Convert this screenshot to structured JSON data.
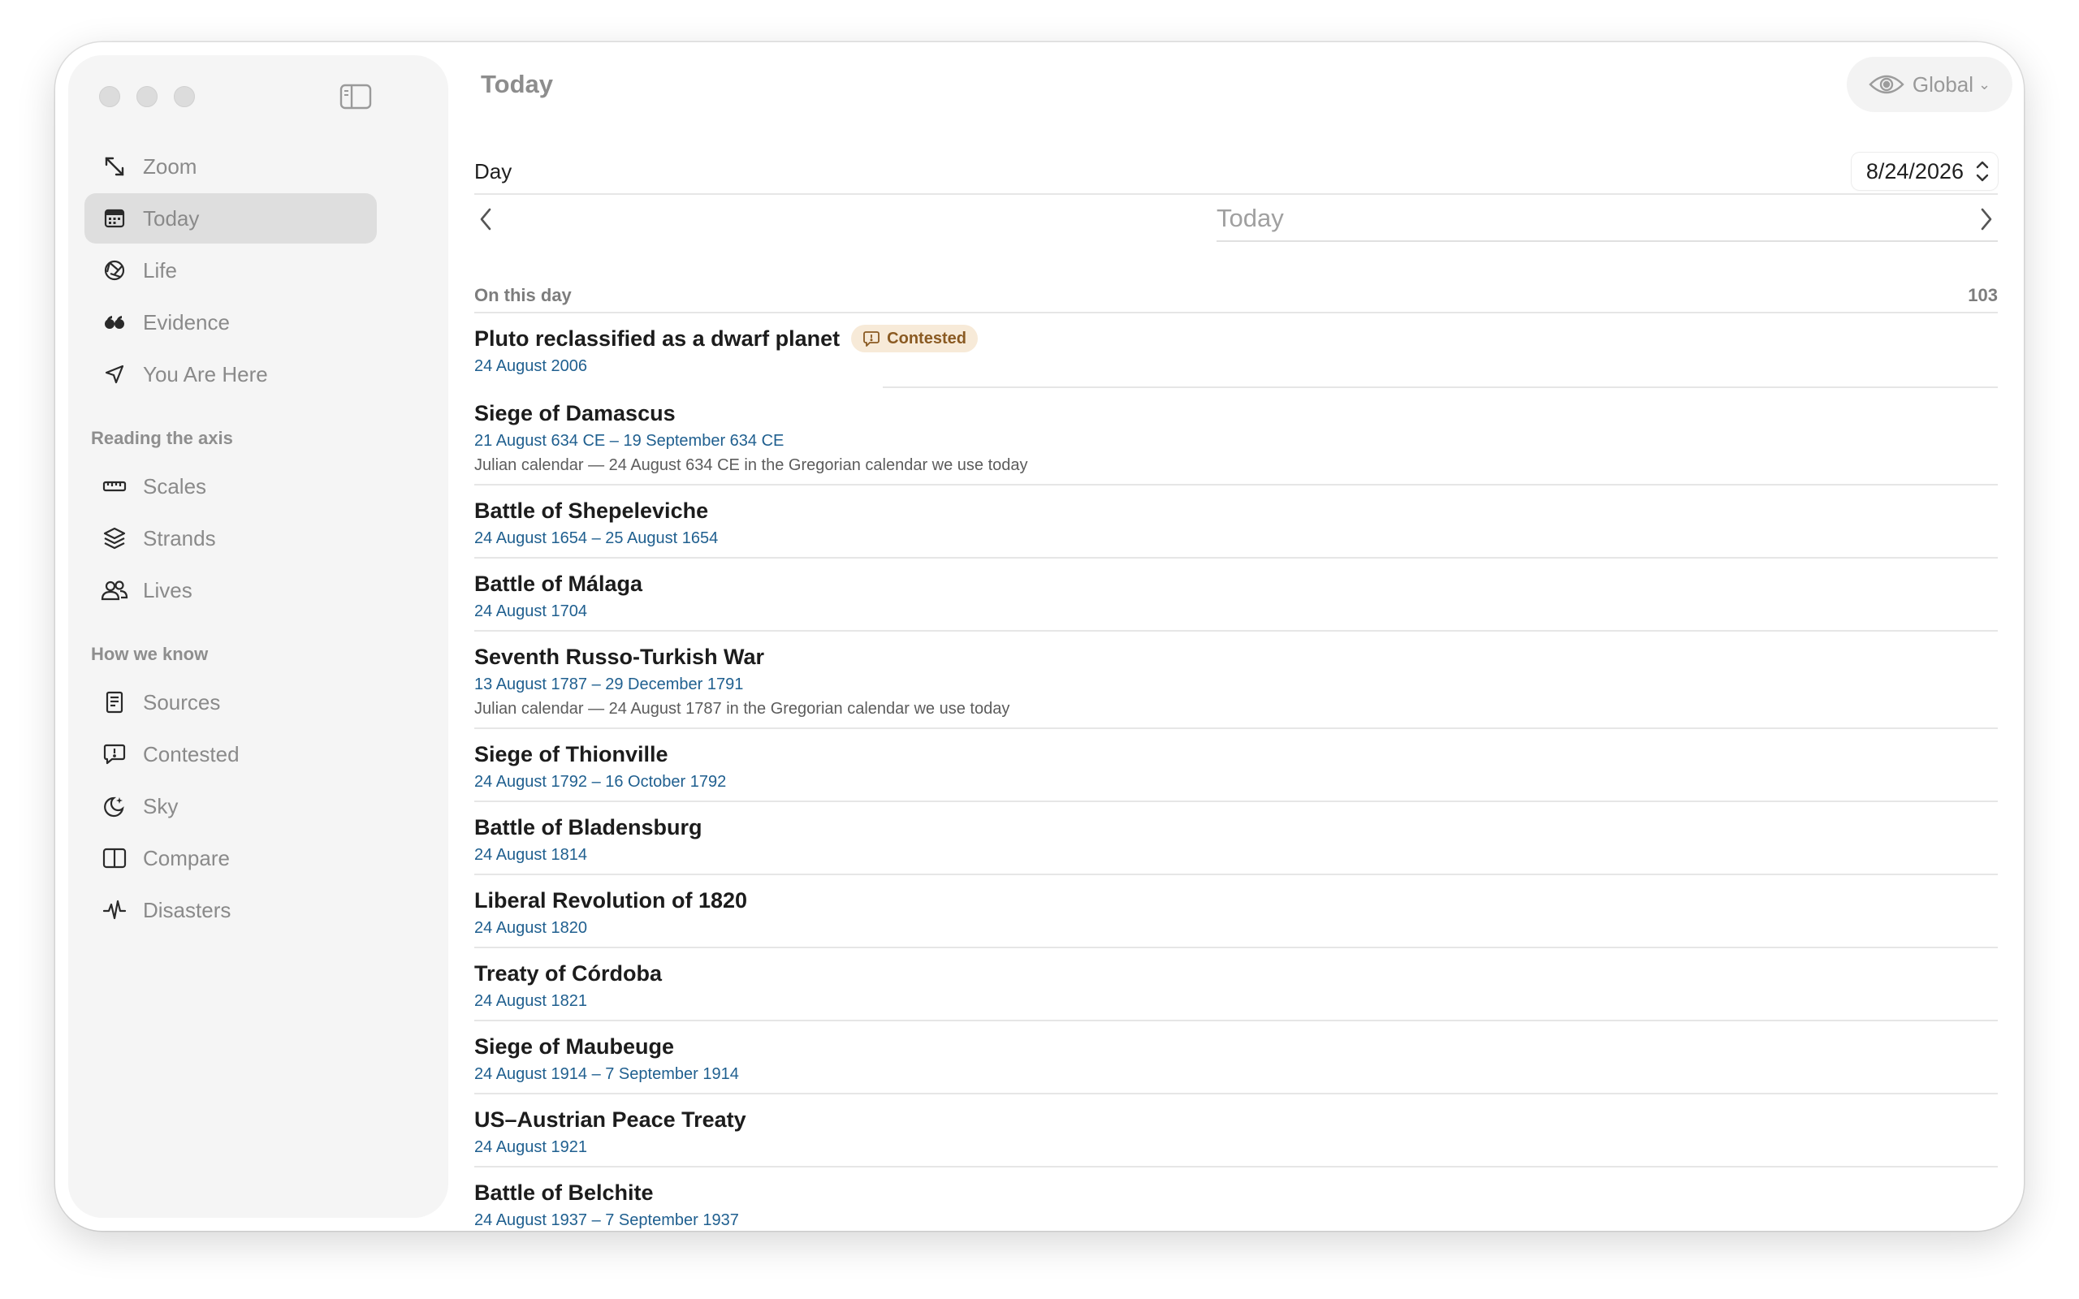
{
  "sidebar": {
    "nav": [
      {
        "label": "Zoom",
        "icon": "arrows-diagonal-icon"
      },
      {
        "label": "Today",
        "icon": "calendar-icon",
        "active": true
      },
      {
        "label": "Life",
        "icon": "aperture-icon"
      },
      {
        "label": "Evidence",
        "icon": "quote-icon"
      },
      {
        "label": "You Are Here",
        "icon": "location-arrow-icon"
      }
    ],
    "section_reading": "Reading the axis",
    "reading": [
      {
        "label": "Scales",
        "icon": "ruler-icon"
      },
      {
        "label": "Strands",
        "icon": "layers-icon"
      },
      {
        "label": "Lives",
        "icon": "people-icon"
      }
    ],
    "section_know": "How we know",
    "know": [
      {
        "label": "Sources",
        "icon": "book-icon"
      },
      {
        "label": "Contested",
        "icon": "speech-bubble-icon"
      },
      {
        "label": "Sky",
        "icon": "moon-stars-icon"
      },
      {
        "label": "Compare",
        "icon": "split-view-icon"
      },
      {
        "label": "Disasters",
        "icon": "waveform-icon"
      }
    ]
  },
  "header": {
    "title": "Today",
    "scope_label": "Global"
  },
  "day_picker": {
    "label": "Day",
    "value": "8/24/2026",
    "nav_label": "Today"
  },
  "list": {
    "heading": "On this day",
    "count": "103",
    "events": [
      {
        "title": "Pluto reclassified as a dwarf planet",
        "badge": "Contested",
        "date": "24 August 2006"
      },
      {
        "title": "Siege of Damascus",
        "date": "21 August 634 CE – 19 September 634 CE",
        "note": "Julian calendar — 24 August 634 CE in the Gregorian calendar we use today"
      },
      {
        "title": "Battle of Shepeleviche",
        "date": "24 August 1654 – 25 August 1654"
      },
      {
        "title": "Battle of Málaga",
        "date": "24 August 1704"
      },
      {
        "title": "Seventh Russo-Turkish War",
        "date": "13 August 1787 – 29 December 1791",
        "note": "Julian calendar — 24 August 1787 in the Gregorian calendar we use today"
      },
      {
        "title": "Siege of Thionville",
        "date": "24 August 1792 – 16 October 1792"
      },
      {
        "title": "Battle of Bladensburg",
        "date": "24 August 1814"
      },
      {
        "title": "Liberal Revolution of 1820",
        "date": "24 August 1820"
      },
      {
        "title": "Treaty of Córdoba",
        "date": "24 August 1821"
      },
      {
        "title": "Siege of Maubeuge",
        "date": "24 August 1914 – 7 September 1914"
      },
      {
        "title": "US–Austrian Peace Treaty",
        "date": "24 August 1921"
      },
      {
        "title": "Battle of Belchite",
        "date": "24 August 1937 – 7 September 1937"
      }
    ]
  }
}
